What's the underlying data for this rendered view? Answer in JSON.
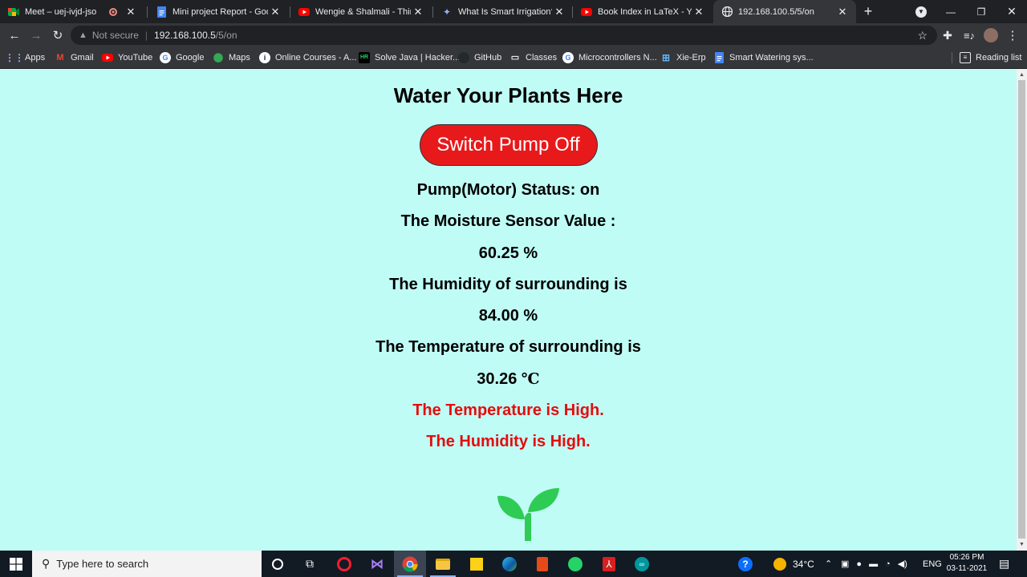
{
  "browser": {
    "tabs": [
      {
        "title": "Meet – uej-ivjd-jso",
        "icon": "google-meet-icon"
      },
      {
        "title": "Mini project Report - Google",
        "icon": "google-docs-icon"
      },
      {
        "title": "Wengie & Shalmali - Thing",
        "icon": "youtube-icon"
      },
      {
        "title": "What Is Smart Irrigation? -",
        "icon": "site-icon"
      },
      {
        "title": "Book Index in LaTeX - YouTube",
        "icon": "youtube-icon"
      },
      {
        "title": "192.168.100.5/5/on",
        "icon": "globe-icon",
        "active": true
      }
    ],
    "address": {
      "security_label": "Not secure",
      "host": "192.168.100.5",
      "path": "/5/on"
    },
    "bookmarks": [
      "Apps",
      "Gmail",
      "YouTube",
      "Google",
      "Maps",
      "Online Courses - A...",
      "Solve Java | Hacker...",
      "GitHub",
      "Classes",
      "Microcontrollers N...",
      "Xie-Erp",
      "Smart Watering sys..."
    ],
    "reading_list": "Reading list"
  },
  "page": {
    "title": "Water Your Plants Here",
    "pump_button": "Switch Pump Off",
    "pump_status": "Pump(Motor) Status: on",
    "moisture_label": "The Moisture Sensor Value :",
    "moisture_value": "60.25 %",
    "humidity_label": "The Humidity of surrounding is",
    "humidity_value": "84.00 %",
    "temperature_label": "The Temperature of surrounding is",
    "temperature_value": "30.26",
    "temperature_unit": "℃",
    "alert_temperature": "The Temperature is High.",
    "alert_humidity": "The Humidity is High.",
    "colors": {
      "background": "#c0fcf6",
      "button": "#e8191b",
      "alert": "#e50d0d",
      "sprout": "#2ecc55"
    }
  },
  "taskbar": {
    "search_placeholder": "Type here to search",
    "weather": "34°C",
    "language": "ENG",
    "time": "05:26 PM",
    "date": "03-11-2021"
  }
}
